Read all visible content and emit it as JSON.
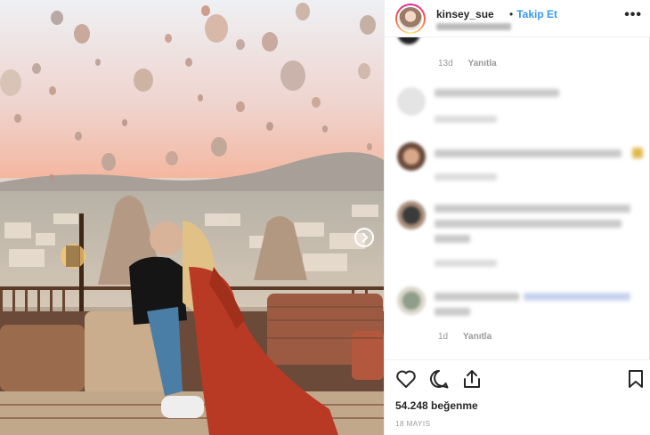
{
  "post": {
    "username": "kinsey_sue",
    "separator": "•",
    "follow_label": "Takip Et",
    "more_label": "•••"
  },
  "comments": [
    {
      "time": "13d",
      "reply_label": "Yanıtla"
    },
    {
      "time": "1d",
      "reply_label": "Yanıtla"
    }
  ],
  "footer": {
    "likes": "54.248 beğenme",
    "date": "18 MAYIS"
  },
  "icons": {
    "heart": "heart-icon",
    "comment": "comment-icon",
    "share": "share-icon",
    "save": "bookmark-icon",
    "more": "more-options-icon"
  },
  "colors": {
    "accent": "#3897f0",
    "text": "#262626",
    "muted": "#999999",
    "dress": "#b83a24"
  }
}
